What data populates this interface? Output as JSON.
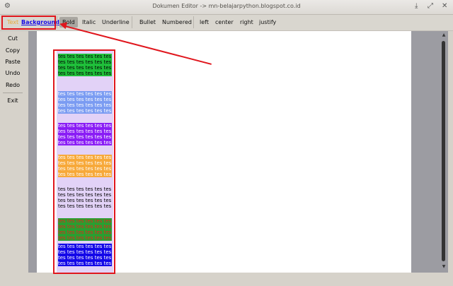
{
  "window": {
    "title": "Dokumen Editor -> mn-belajarpython.blogspot.co.id"
  },
  "toolbar": {
    "text_label": "Text",
    "background_label": "Background",
    "bold_label": "Bold",
    "italic_label": "Italic",
    "underline_label": "Underline",
    "bullet_label": "Bullet",
    "numbered_label": "Numbered",
    "left_label": "left",
    "center_label": "center",
    "right_label": "right",
    "justify_label": "justify"
  },
  "sidebar": {
    "cut": "Cut",
    "copy": "Copy",
    "paste": "Paste",
    "undo": "Undo",
    "redo": "Redo",
    "exit": "Exit"
  },
  "editor": {
    "line_text": "tes tes tes tes tes tes",
    "blocks": [
      {
        "fg": "#000000",
        "bg": "#1fbf3a"
      },
      {
        "fg": "#ffffff",
        "bg": "#7b9cf2"
      },
      {
        "fg": "#ffffff",
        "bg": "#8a1df5"
      },
      {
        "fg": "#ffffff",
        "bg": "#f7a93a"
      },
      {
        "fg": "#000000",
        "bg": "#e2d2f7"
      },
      {
        "fg": "#e8231d",
        "bg": "#2a9e30"
      },
      {
        "fg": "#ffffff",
        "bg": "#1408e8"
      }
    ]
  },
  "colors": {
    "highlight": "#e0161d",
    "window_bg": "#d6d2ca",
    "editor_panel": "#e2d2f7"
  }
}
